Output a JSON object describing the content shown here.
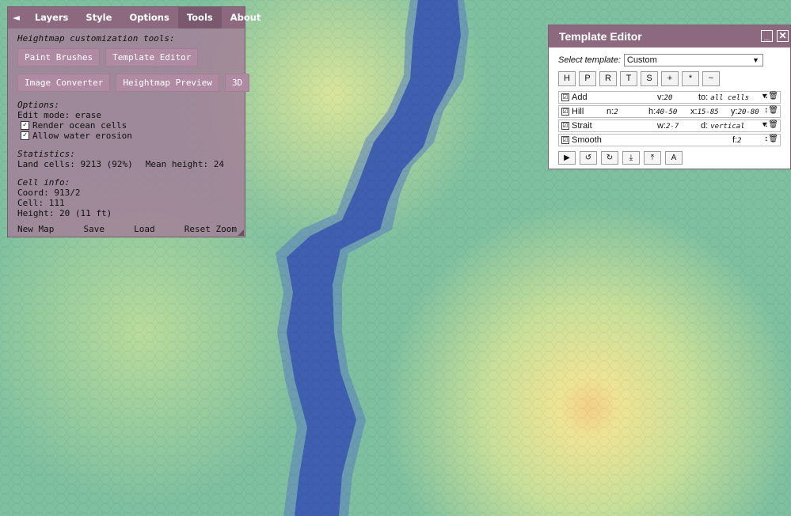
{
  "tabs": {
    "back": "◄",
    "layers": "Layers",
    "style": "Style",
    "options": "Options",
    "tools": "Tools",
    "about": "About"
  },
  "tools_panel": {
    "heading": "Heightmap customization tools:",
    "buttons_row1": [
      "Paint Brushes",
      "Template Editor"
    ],
    "buttons_row2": [
      "Image Converter",
      "Heightmap Preview",
      "3D"
    ],
    "options_title": "Options:",
    "edit_mode": "Edit mode: erase",
    "render_ocean": "Render ocean cells",
    "water_erosion": "Allow water erosion",
    "statistics_title": "Statistics:",
    "land_cells": "Land cells: 9213 (92%)",
    "mean_height": "Mean height: 24",
    "cell_info_title": "Cell info:",
    "coord": "Coord: 913/2",
    "cell": "Cell: 111",
    "height": "Height: 20 (11 ft)",
    "bottom": {
      "new_map": "New Map",
      "save": "Save",
      "load": "Load",
      "reset_zoom": "Reset Zoom"
    }
  },
  "template_editor": {
    "title": "Template Editor",
    "minimize": "_",
    "close": "✕",
    "select_label": "Select template:",
    "selected": "Custom",
    "letters": [
      "H",
      "P",
      "R",
      "T",
      "S",
      "+",
      "*",
      "~"
    ],
    "steps": [
      {
        "name": "Add",
        "f1": "v:",
        "v1": "20",
        "f2": "to:",
        "v2": "all cells"
      },
      {
        "name": "Hill",
        "f1": "n:",
        "v1": "2",
        "f2": "h:",
        "v2": "40-50",
        "f3": "x:",
        "v3": "15-85",
        "f4": "y:",
        "v4": "20-80"
      },
      {
        "name": "Strait",
        "f1": "w:",
        "v1": "2-7",
        "f2": "d:",
        "v2": "vertical"
      },
      {
        "name": "Smooth",
        "f1": "f:",
        "v1": "2"
      }
    ],
    "checkmark": "☑",
    "dropdown_arrow": "▼",
    "row_controls": "↕🗑",
    "actions": [
      "▶",
      "↺",
      "↻",
      "⤓",
      "⤒",
      "A"
    ]
  },
  "colors": {
    "panel": "#a38098",
    "header": "#8d6980",
    "land_low": "#7ec0a0",
    "land_high": "#f0e08a",
    "river": "#4060b0"
  }
}
